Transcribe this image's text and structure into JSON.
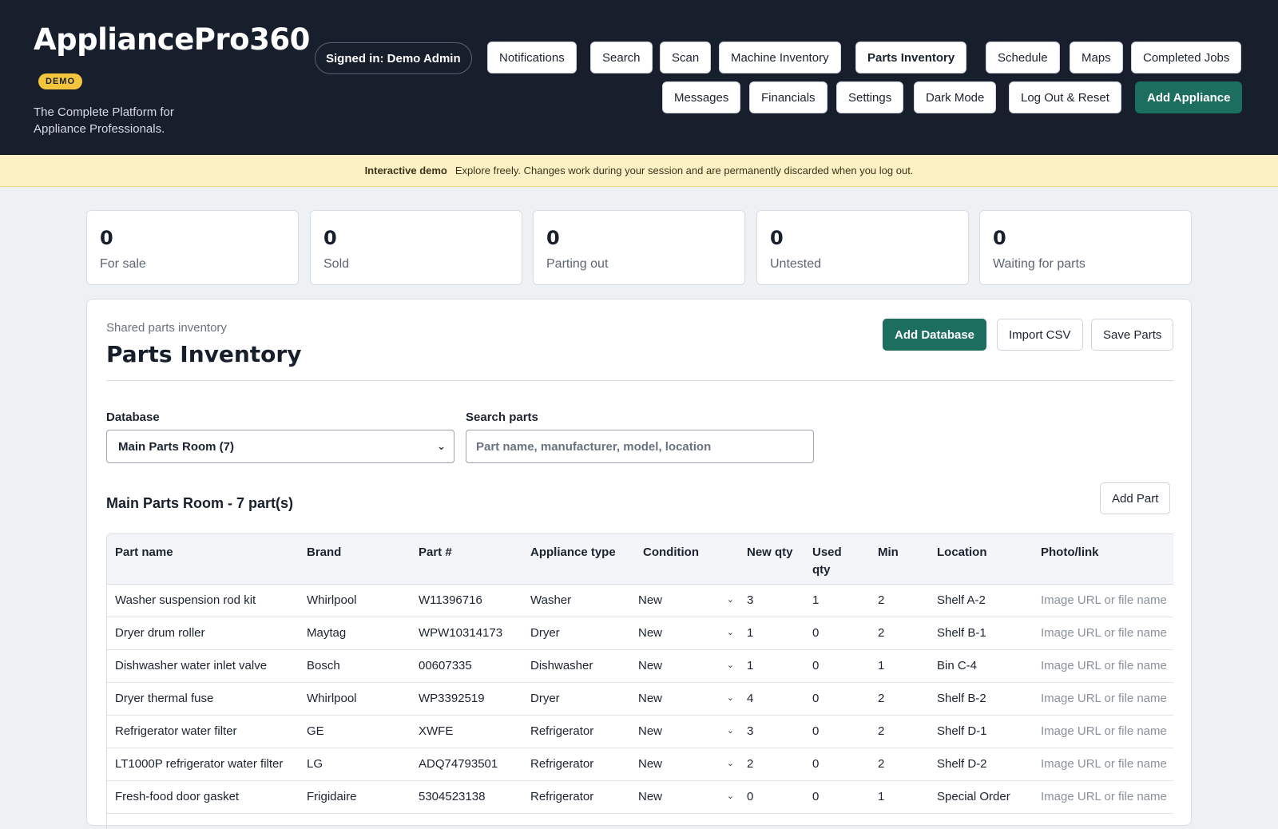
{
  "header": {
    "app_title": "AppliancePro360",
    "badge": "DEMO",
    "tagline": "The Complete Platform for Appliance Professionals.",
    "signed_in": "Signed in: Demo Admin",
    "nav_row1": [
      "Notifications",
      "Search",
      "Scan",
      "Machine Inventory",
      "Parts Inventory",
      "Schedule",
      "Maps",
      "Completed Jobs"
    ],
    "nav_row2": [
      "Messages",
      "Financials",
      "Settings",
      "Dark Mode",
      "Log Out & Reset",
      "Add Appliance"
    ],
    "active_nav": "Parts Inventory"
  },
  "demo_notice": {
    "label": "Interactive demo",
    "text": "Explore freely. Changes work during your session and are permanently discarded when you log out."
  },
  "stats": [
    {
      "value": "0",
      "label": "For sale"
    },
    {
      "value": "0",
      "label": "Sold"
    },
    {
      "value": "0",
      "label": "Parting out"
    },
    {
      "value": "0",
      "label": "Untested"
    },
    {
      "value": "0",
      "label": "Waiting for parts"
    }
  ],
  "panel": {
    "eyebrow": "Shared parts inventory",
    "title": "Parts Inventory",
    "buttons": {
      "add_database": "Add Database",
      "import_csv": "Import CSV",
      "save_parts": "Save Parts"
    },
    "database_label": "Database",
    "database_value": "Main Parts Room (7)",
    "search_label": "Search parts",
    "search_placeholder": "Part name, manufacturer, model, location",
    "section_title": "Main Parts Room - 7 part(s)",
    "add_part": "Add Part"
  },
  "table": {
    "headers": [
      "Part name",
      "Brand",
      "Part #",
      "Appliance type",
      "Condition",
      "New qty",
      "Used qty",
      "Min",
      "Location",
      "Photo/link"
    ],
    "photo_placeholder": "Image URL or file name",
    "rows": [
      [
        "Washer suspension rod kit",
        "Whirlpool",
        "W11396716",
        "Washer",
        "New",
        "3",
        "1",
        "2",
        "Shelf A-2"
      ],
      [
        "Dryer drum roller",
        "Maytag",
        "WPW10314173",
        "Dryer",
        "New",
        "1",
        "0",
        "2",
        "Shelf B-1"
      ],
      [
        "Dishwasher water inlet valve",
        "Bosch",
        "00607335",
        "Dishwasher",
        "New",
        "1",
        "0",
        "1",
        "Bin C-4"
      ],
      [
        "Dryer thermal fuse",
        "Whirlpool",
        "WP3392519",
        "Dryer",
        "New",
        "4",
        "0",
        "2",
        "Shelf B-2"
      ],
      [
        "Refrigerator water filter",
        "GE",
        "XWFE",
        "Refrigerator",
        "New",
        "3",
        "0",
        "2",
        "Shelf D-1"
      ],
      [
        "LT1000P refrigerator water filter",
        "LG",
        "ADQ74793501",
        "Refrigerator",
        "New",
        "2",
        "0",
        "2",
        "Shelf D-2"
      ],
      [
        "Fresh-food door gasket",
        "Frigidaire",
        "5304523138",
        "Refrigerator",
        "New",
        "0",
        "0",
        "1",
        "Special Order"
      ]
    ]
  }
}
